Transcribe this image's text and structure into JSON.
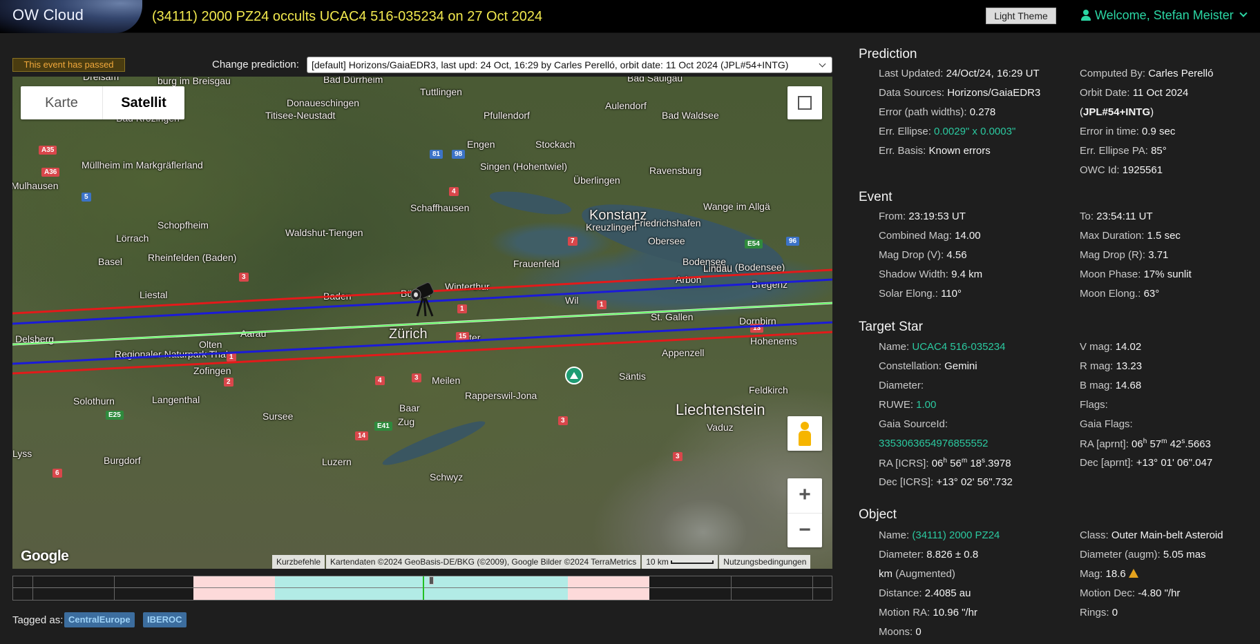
{
  "header": {
    "brand": "OW Cloud",
    "event_title": "(34111) 2000 PZ24 occults UCAC4 516-035234 on 27 Oct 2024",
    "theme_button": "Light Theme",
    "welcome": "Welcome, Stefan Meister"
  },
  "status": {
    "passed": "This event has passed"
  },
  "prediction_selector": {
    "label": "Change prediction:",
    "selected": "[default] Horizons/GaiaEDR3, last upd: 24 Oct, 16:29 by Carles Perelló, orbit date: 11 Oct 2024 (JPL#54+INTG)"
  },
  "map": {
    "type_options": [
      "Karte",
      "Satellit"
    ],
    "active_type": "Satellit",
    "logo": "Google",
    "footer": [
      "Kurzbefehle",
      "Kartendaten ©2024 GeoBasis-DE/BKG (©2009), Google Bilder ©2024 TerraMetrics",
      "10 km",
      "Nutzungsbedingungen"
    ],
    "cities": [
      {
        "name": "Bad Dürrheim"
      },
      {
        "name": "Bad Saulgau"
      },
      {
        "name": "Donaueschingen"
      },
      {
        "name": "Tuttlingen"
      },
      {
        "name": "Aulendorf"
      },
      {
        "name": "Titisee-Neustadt"
      },
      {
        "name": "Pfullendorf"
      },
      {
        "name": "Bad Waldsee"
      },
      {
        "name": "Bad Krozingen"
      },
      {
        "name": "Engen"
      },
      {
        "name": "Stockach"
      },
      {
        "name": "Müllheim im Markgräflerland"
      },
      {
        "name": "Singen (Hohentwiel)"
      },
      {
        "name": "Überlingen"
      },
      {
        "name": "Ravensburg"
      },
      {
        "name": "Mulhausen"
      },
      {
        "name": "Schaffhausen"
      },
      {
        "name": "Konstanz"
      },
      {
        "name": "Kreuzlingen"
      },
      {
        "name": "Friedrichshafen"
      },
      {
        "name": "Wange im Allgä"
      },
      {
        "name": "Schopfheim"
      },
      {
        "name": "Waldshut-Tiengen"
      },
      {
        "name": "Lörrach"
      },
      {
        "name": "Basel"
      },
      {
        "name": "Rheinfelden (Baden)"
      },
      {
        "name": "Frauenfeld"
      },
      {
        "name": "Lindau (Bodensee)"
      },
      {
        "name": "Bülach"
      },
      {
        "name": "Winterthur"
      },
      {
        "name": "Arbon"
      },
      {
        "name": "Bregenz"
      },
      {
        "name": "Liestal"
      },
      {
        "name": "Baden"
      },
      {
        "name": "Wil"
      },
      {
        "name": "St. Gallen"
      },
      {
        "name": "Zürich"
      },
      {
        "name": "Uster"
      },
      {
        "name": "Aarau"
      },
      {
        "name": "Dornbirn"
      },
      {
        "name": "Delsberg"
      },
      {
        "name": "Hohenems"
      },
      {
        "name": "Appenzell"
      },
      {
        "name": "Olten"
      },
      {
        "name": "Regionaler Naturpark Thal"
      },
      {
        "name": "Zofingen"
      },
      {
        "name": "Meilen"
      },
      {
        "name": "Säntis"
      },
      {
        "name": "Feldkirch"
      },
      {
        "name": "Rapperswil-Jona"
      },
      {
        "name": "Langenthal"
      },
      {
        "name": "Solothurn"
      },
      {
        "name": "Liechtenstein"
      },
      {
        "name": "Sursee"
      },
      {
        "name": "Baar"
      },
      {
        "name": "Zug"
      },
      {
        "name": "Vaduz"
      },
      {
        "name": "Burgdorf"
      },
      {
        "name": "Luzern"
      },
      {
        "name": "Lyss"
      },
      {
        "name": "Schwyz"
      },
      {
        "name": "Obersee"
      },
      {
        "name": "Bodensee"
      },
      {
        "name": "Lindau"
      },
      {
        "name": "Dreisam"
      },
      {
        "name": "burg im Breisgau"
      }
    ],
    "roads": [
      "A35",
      "A36",
      "5",
      "81",
      "98",
      "4",
      "7",
      "E54",
      "96",
      "3",
      "1",
      "1",
      "15",
      "13",
      "1",
      "2",
      "4",
      "3",
      "E25",
      "E41",
      "14",
      "3",
      "3",
      "6"
    ]
  },
  "timeline": {
    "segments": [
      {
        "from": 0.22,
        "to": 0.32,
        "color": "#fddada"
      },
      {
        "from": 0.32,
        "to": 0.678,
        "color": "#b2ebe6"
      },
      {
        "from": 0.678,
        "to": 0.777,
        "color": "#fddada"
      }
    ],
    "center_line": 0.5,
    "colors": {
      "outer": "#fddada",
      "inner": "#b2ebe6",
      "center": "#22c022"
    }
  },
  "tags": {
    "label": "Tagged as:",
    "items": [
      "CentralEurope",
      "IBEROC"
    ]
  },
  "prediction": {
    "title": "Prediction",
    "last_updated_label": "Last Updated:",
    "last_updated": "24/Oct/24, 16:29 UT",
    "computed_by_label": "Computed By:",
    "computed_by": "Carles Perelló",
    "data_sources_label": "Data Sources:",
    "data_sources": "Horizons/GaiaEDR3",
    "orbit_date_label": "Orbit Date:",
    "orbit_date": "11 Oct 2024",
    "orbit_code": "JPL#54+INTG",
    "error_paths_label": "Error (path widths):",
    "error_paths": "0.278",
    "err_ellipse_label": "Err. Ellipse:",
    "err_ellipse": "0.0029\" x 0.0003\"",
    "error_time_label": "Error in time:",
    "error_time": "0.9 sec",
    "err_basis_label": "Err. Basis:",
    "err_basis": "Known errors",
    "err_pa_label": "Err. Ellipse PA:",
    "err_pa": "85°",
    "owc_id_label": "OWC Id:",
    "owc_id": "1925561"
  },
  "event": {
    "title": "Event",
    "from_label": "From:",
    "from": "23:19:53 UT",
    "to_label": "To:",
    "to": "23:54:11 UT",
    "combined_mag_label": "Combined Mag:",
    "combined_mag": "14.00",
    "max_duration_label": "Max Duration:",
    "max_duration": "1.5 sec",
    "mag_drop_v_label": "Mag Drop (V):",
    "mag_drop_v": "4.56",
    "mag_drop_r_label": "Mag Drop (R):",
    "mag_drop_r": "3.71",
    "shadow_width_label": "Shadow Width:",
    "shadow_width": "9.4 km",
    "moon_phase_label": "Moon Phase:",
    "moon_phase": "17% sunlit",
    "solar_elong_label": "Solar Elong.:",
    "solar_elong": "110°",
    "moon_elong_label": "Moon Elong.:",
    "moon_elong": "63°"
  },
  "target_star": {
    "title": "Target Star",
    "name_label": "Name:",
    "name": "UCAC4 516-035234",
    "vmag_label": "V mag:",
    "vmag": "14.02",
    "constellation_label": "Constellation:",
    "constellation": "Gemini",
    "rmag_label": "R mag:",
    "rmag": "13.23",
    "diameter_label": "Diameter:",
    "bmag_label": "B mag:",
    "bmag": "14.68",
    "ruwe_label": "RUWE:",
    "ruwe": "1.00",
    "flags_label": "Flags:",
    "gaia_source_label": "Gaia SourceId:",
    "gaia_flags_label": "Gaia Flags:",
    "gaia_source": "3353063654976855552",
    "ra_aprnt_label": "RA [aprnt]:",
    "ra_aprnt": "06h 57m 42s.5663",
    "ra_icrs_label": "RA [ICRS]:",
    "ra_icrs": "06h 56m 18s.3978",
    "dec_aprnt_label": "Dec [aprnt]:",
    "dec_aprnt": "+13° 01' 06\".047",
    "dec_icrs_label": "Dec [ICRS]:",
    "dec_icrs": "+13° 02' 56\".732"
  },
  "object": {
    "title": "Object",
    "name_label": "Name:",
    "name": "(34111) 2000 PZ24",
    "class_label": "Class:",
    "class": "Outer Main-belt Asteroid",
    "diameter_label": "Diameter:",
    "diameter": "8.826 ± 0.8",
    "diameter_augm_label": "Diameter (augm):",
    "diameter_augm": "5.05 mas",
    "diameter_unit": "km",
    "diameter_note": "(Augmented)",
    "mag_label": "Mag:",
    "mag": "18.6",
    "distance_label": "Distance:",
    "distance": "2.4085 au",
    "motion_dec_label": "Motion Dec:",
    "motion_dec": "-4.80 \"/hr",
    "motion_ra_label": "Motion RA:",
    "motion_ra": "10.96 \"/hr",
    "rings_label": "Rings:",
    "rings": "0",
    "moons_label": "Moons:",
    "moons": "0"
  }
}
